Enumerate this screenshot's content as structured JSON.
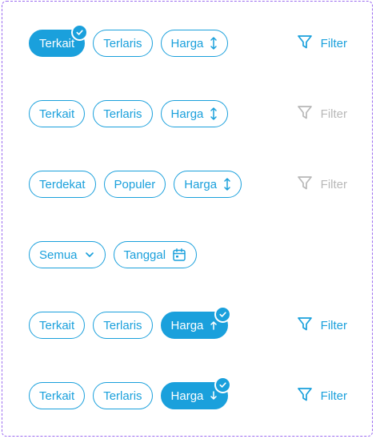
{
  "colors": {
    "accent": "#1aa0dc",
    "disabled": "#b8b8b8",
    "frame": "#9b6bf0"
  },
  "rows": [
    {
      "chips": [
        "Terkait",
        "Terlaris",
        "Harga"
      ],
      "filter": "Filter"
    },
    {
      "chips": [
        "Terkait",
        "Terlaris",
        "Harga"
      ],
      "filter": "Filter"
    },
    {
      "chips": [
        "Terdekat",
        "Populer",
        "Harga"
      ],
      "filter": "Filter"
    },
    {
      "chips": [
        "Semua",
        "Tanggal"
      ]
    },
    {
      "chips": [
        "Terkait",
        "Terlaris",
        "Harga"
      ],
      "filter": "Filter"
    },
    {
      "chips": [
        "Terkait",
        "Terlaris",
        "Harga"
      ],
      "filter": "Filter"
    }
  ],
  "icons": {
    "sort": "sort-both-icon",
    "asc": "arrow-up-icon",
    "desc": "arrow-down-icon",
    "calendar": "calendar-icon",
    "dropdown": "chevron-down-icon",
    "filter": "filter-funnel-icon",
    "check": "check-badge-icon"
  }
}
